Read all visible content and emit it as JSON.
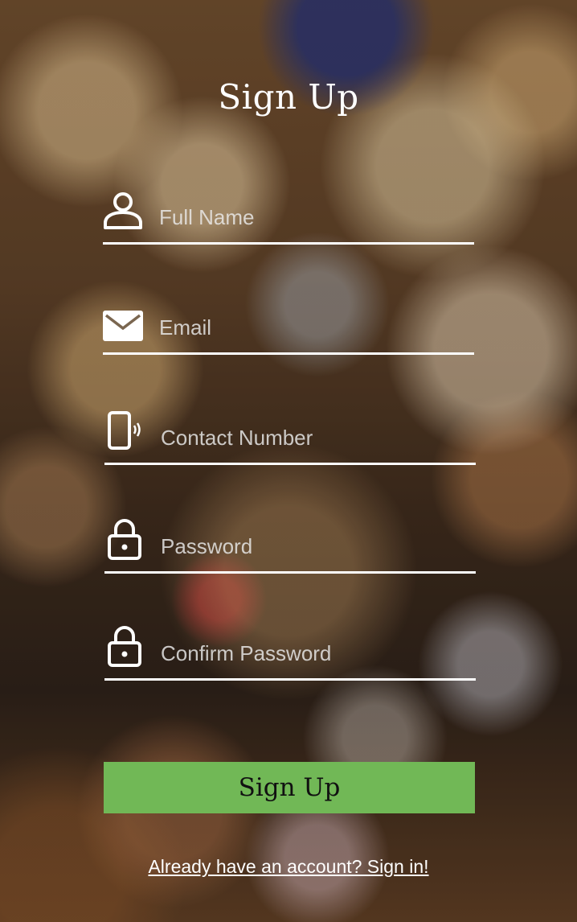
{
  "form": {
    "title": "Sign Up",
    "fields": {
      "full_name": {
        "placeholder": "Full Name",
        "value": "",
        "icon": "user-icon"
      },
      "email": {
        "placeholder": "Email",
        "value": "",
        "icon": "envelope-icon"
      },
      "contact": {
        "placeholder": "Contact Number",
        "value": "",
        "icon": "phone-icon"
      },
      "password": {
        "placeholder": "Password",
        "value": "",
        "icon": "lock-icon"
      },
      "confirm_password": {
        "placeholder": "Confirm Password",
        "value": "",
        "icon": "lock-icon"
      }
    },
    "submit_label": "Sign Up",
    "signin_text": "Already have an account? Sign in!"
  },
  "colors": {
    "accent": "#71b856",
    "text": "#ffffff",
    "button_text": "#111111"
  }
}
